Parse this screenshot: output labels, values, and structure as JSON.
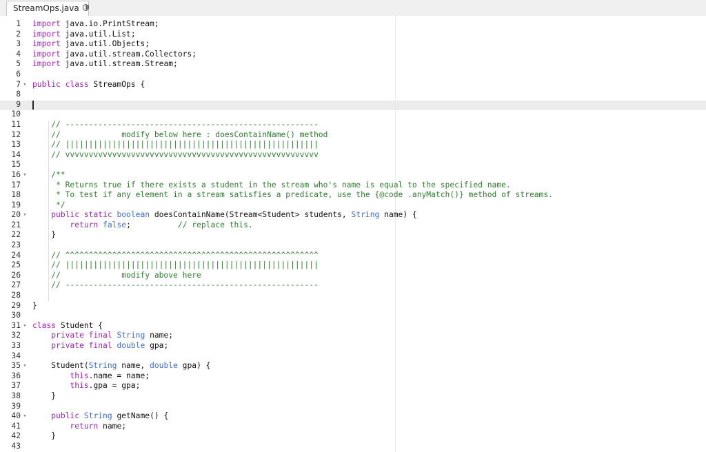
{
  "tab": {
    "filename": "StreamOps.java",
    "icon": "shield-icon"
  },
  "lines": [
    {
      "n": "1",
      "fold": "",
      "code": [
        [
          "k",
          "import"
        ],
        [
          "p",
          " java.io.PrintStream;"
        ]
      ]
    },
    {
      "n": "2",
      "fold": "",
      "code": [
        [
          "k",
          "import"
        ],
        [
          "p",
          " java.util.List;"
        ]
      ]
    },
    {
      "n": "3",
      "fold": "",
      "code": [
        [
          "k",
          "import"
        ],
        [
          "p",
          " java.util.Objects;"
        ]
      ]
    },
    {
      "n": "4",
      "fold": "",
      "code": [
        [
          "k",
          "import"
        ],
        [
          "p",
          " java.util.stream.Collectors;"
        ]
      ]
    },
    {
      "n": "5",
      "fold": "",
      "code": [
        [
          "k",
          "import"
        ],
        [
          "p",
          " java.util.stream.Stream;"
        ]
      ]
    },
    {
      "n": "6",
      "fold": "",
      "code": []
    },
    {
      "n": "7",
      "fold": "▾",
      "code": [
        [
          "k",
          "public class"
        ],
        [
          "p",
          " StreamOps {"
        ]
      ]
    },
    {
      "n": "8",
      "fold": "",
      "code": []
    },
    {
      "n": "9",
      "fold": "",
      "code": []
    },
    {
      "n": "10",
      "fold": "",
      "code": []
    },
    {
      "n": "11",
      "fold": "",
      "code": [
        [
          "c",
          "    // ------------------------------------------------------"
        ]
      ]
    },
    {
      "n": "12",
      "fold": "",
      "code": [
        [
          "c",
          "    //             modify below here : doesContainName() method"
        ]
      ]
    },
    {
      "n": "13",
      "fold": "",
      "code": [
        [
          "c",
          "    // ||||||||||||||||||||||||||||||||||||||||||||||||||||||"
        ]
      ]
    },
    {
      "n": "14",
      "fold": "",
      "code": [
        [
          "c",
          "    // vvvvvvvvvvvvvvvvvvvvvvvvvvvvvvvvvvvvvvvvvvvvvvvvvvvvvv"
        ]
      ]
    },
    {
      "n": "15",
      "fold": "",
      "code": []
    },
    {
      "n": "16",
      "fold": "▾",
      "code": [
        [
          "c",
          "    /**"
        ]
      ]
    },
    {
      "n": "17",
      "fold": "",
      "code": [
        [
          "c",
          "     * Returns true if there exists a student in the stream who's name is equal to the specified name."
        ]
      ]
    },
    {
      "n": "18",
      "fold": "",
      "code": [
        [
          "c",
          "     * To test if any element in a stream satisfies a predicate, use the {@code .anyMatch()} method of streams."
        ]
      ]
    },
    {
      "n": "19",
      "fold": "",
      "code": [
        [
          "c",
          "     */"
        ]
      ]
    },
    {
      "n": "20",
      "fold": "▾",
      "code": [
        [
          "p",
          "    "
        ],
        [
          "k",
          "public static"
        ],
        [
          "p",
          " "
        ],
        [
          "t",
          "boolean"
        ],
        [
          "p",
          " doesContainName(Stream<Student> students, "
        ],
        [
          "t",
          "String"
        ],
        [
          "p",
          " name) {"
        ]
      ]
    },
    {
      "n": "21",
      "fold": "",
      "code": [
        [
          "p",
          "        "
        ],
        [
          "k",
          "return"
        ],
        [
          "p",
          " "
        ],
        [
          "t",
          "false"
        ],
        [
          "p",
          ";          "
        ],
        [
          "c",
          "// replace this."
        ]
      ]
    },
    {
      "n": "22",
      "fold": "",
      "code": [
        [
          "p",
          "    }"
        ]
      ]
    },
    {
      "n": "23",
      "fold": "",
      "code": []
    },
    {
      "n": "24",
      "fold": "",
      "code": [
        [
          "c",
          "    // ^^^^^^^^^^^^^^^^^^^^^^^^^^^^^^^^^^^^^^^^^^^^^^^^^^^^^^"
        ]
      ]
    },
    {
      "n": "25",
      "fold": "",
      "code": [
        [
          "c",
          "    // ||||||||||||||||||||||||||||||||||||||||||||||||||||||"
        ]
      ]
    },
    {
      "n": "26",
      "fold": "",
      "code": [
        [
          "c",
          "    //             modify above here"
        ]
      ]
    },
    {
      "n": "27",
      "fold": "",
      "code": [
        [
          "c",
          "    // ------------------------------------------------------"
        ]
      ]
    },
    {
      "n": "28",
      "fold": "",
      "code": []
    },
    {
      "n": "29",
      "fold": "",
      "code": [
        [
          "p",
          "}"
        ]
      ]
    },
    {
      "n": "30",
      "fold": "",
      "code": []
    },
    {
      "n": "31",
      "fold": "▾",
      "code": [
        [
          "k",
          "class"
        ],
        [
          "p",
          " Student {"
        ]
      ]
    },
    {
      "n": "32",
      "fold": "",
      "code": [
        [
          "p",
          "    "
        ],
        [
          "k",
          "private final"
        ],
        [
          "p",
          " "
        ],
        [
          "t",
          "String"
        ],
        [
          "p",
          " name;"
        ]
      ]
    },
    {
      "n": "33",
      "fold": "",
      "code": [
        [
          "p",
          "    "
        ],
        [
          "k",
          "private final"
        ],
        [
          "p",
          " "
        ],
        [
          "t",
          "double"
        ],
        [
          "p",
          " gpa;"
        ]
      ]
    },
    {
      "n": "34",
      "fold": "",
      "code": []
    },
    {
      "n": "35",
      "fold": "▾",
      "code": [
        [
          "p",
          "    Student("
        ],
        [
          "t",
          "String"
        ],
        [
          "p",
          " name, "
        ],
        [
          "t",
          "double"
        ],
        [
          "p",
          " gpa) {"
        ]
      ]
    },
    {
      "n": "36",
      "fold": "",
      "code": [
        [
          "p",
          "        "
        ],
        [
          "k",
          "this"
        ],
        [
          "p",
          ".name = name;"
        ]
      ]
    },
    {
      "n": "37",
      "fold": "",
      "code": [
        [
          "p",
          "        "
        ],
        [
          "k",
          "this"
        ],
        [
          "p",
          ".gpa = gpa;"
        ]
      ]
    },
    {
      "n": "38",
      "fold": "",
      "code": [
        [
          "p",
          "    }"
        ]
      ]
    },
    {
      "n": "39",
      "fold": "",
      "code": []
    },
    {
      "n": "40",
      "fold": "▾",
      "code": [
        [
          "p",
          "    "
        ],
        [
          "k",
          "public"
        ],
        [
          "p",
          " "
        ],
        [
          "t",
          "String"
        ],
        [
          "p",
          " getName() {"
        ]
      ]
    },
    {
      "n": "41",
      "fold": "",
      "code": [
        [
          "p",
          "        "
        ],
        [
          "k",
          "return"
        ],
        [
          "p",
          " name;"
        ]
      ]
    },
    {
      "n": "42",
      "fold": "",
      "code": [
        [
          "p",
          "    }"
        ]
      ]
    },
    {
      "n": "43",
      "fold": "",
      "code": []
    }
  ],
  "cursor_line": "9"
}
